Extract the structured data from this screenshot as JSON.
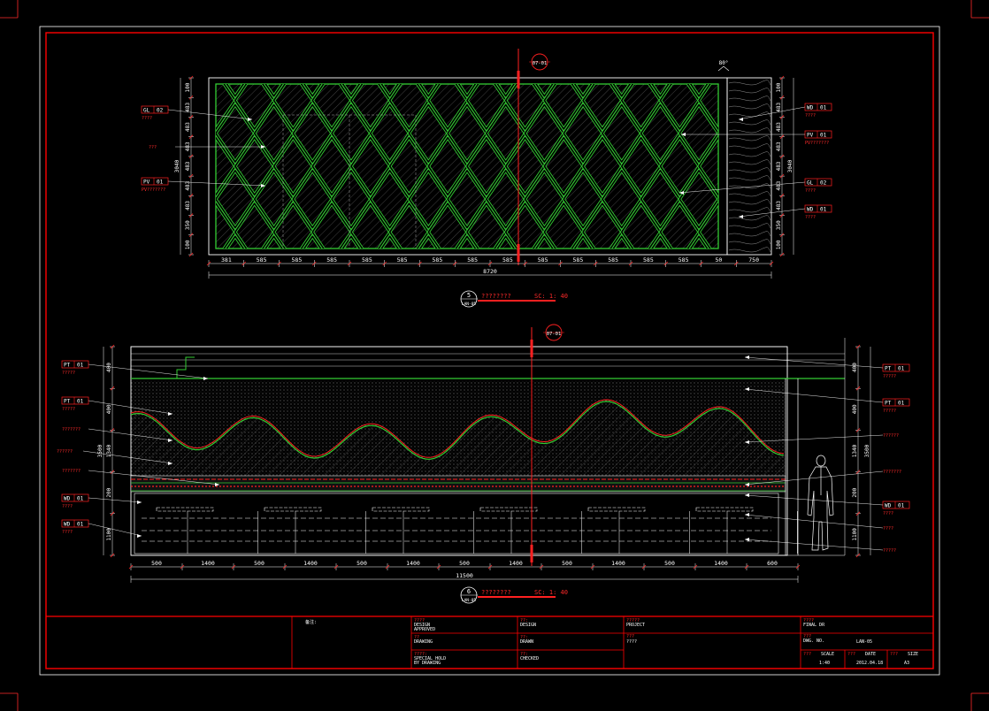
{
  "colors": {
    "background": "#000000",
    "frame": "#ff0000",
    "line": "#ffffff",
    "pattern": "#33cc33",
    "label": "#ff2a2a"
  },
  "top_elevation": {
    "section_mark": "07-01",
    "angle": "80°",
    "label_number": "5",
    "label_sheet": "LAN-05",
    "label_title": "????????",
    "label_scale": "SC: 1: 40",
    "dims_bottom": [
      "381",
      "585",
      "585",
      "585",
      "585",
      "585",
      "585",
      "585",
      "585",
      "585",
      "585",
      "585",
      "585",
      "585",
      "50",
      "750"
    ],
    "total": "8720",
    "dims_left": [
      "100",
      "483",
      "483",
      "483",
      "483",
      "483",
      "483",
      "350",
      "100"
    ],
    "dim_left_total": "3040",
    "dims_right": [
      "100",
      "483",
      "483",
      "483",
      "483",
      "483",
      "483",
      "350",
      "100"
    ],
    "dim_right_total": "3040",
    "left_tags": [
      {
        "code": "GL",
        "num": "02",
        "note": "????"
      },
      {
        "code": "",
        "num": "",
        "note": "???"
      },
      {
        "code": "PV",
        "num": "01",
        "note": "PV???????"
      }
    ],
    "right_tags": [
      {
        "code": "WD",
        "num": "01",
        "note": "????"
      },
      {
        "code": "PV",
        "num": "01",
        "note": "PV???????"
      },
      {
        "code": "GL",
        "num": "02",
        "note": "????"
      },
      {
        "code": "WD",
        "num": "01",
        "note": "????"
      }
    ]
  },
  "bottom_elevation": {
    "section_mark": "07-01",
    "label_number": "6",
    "label_sheet": "LAN-05",
    "label_title": "????????",
    "label_scale": "SC: 1: 40",
    "dims_bottom": [
      "500",
      "1400",
      "500",
      "1400",
      "500",
      "1400",
      "500",
      "1400",
      "500",
      "1400",
      "500",
      "1400",
      "600"
    ],
    "total": "11500",
    "dims_left": [
      "400",
      "400",
      "1340",
      "200",
      "1100"
    ],
    "dim_left_total": "3500",
    "dims_right": [
      "400",
      "400",
      "1340",
      "200",
      "1100"
    ],
    "dim_right_total": "3500",
    "left_tags": [
      {
        "code": "PT",
        "num": "01",
        "note": "?????"
      },
      {
        "code": "PT",
        "num": "01",
        "note": "?????"
      },
      {
        "code": "",
        "num": "",
        "note": "???????"
      },
      {
        "code": "",
        "num": "",
        "note": "??????"
      },
      {
        "code": "",
        "num": "",
        "note": "???????"
      },
      {
        "code": "WD",
        "num": "01",
        "note": "????"
      },
      {
        "code": "WD",
        "num": "01",
        "note": "????"
      }
    ],
    "right_tags": [
      {
        "code": "PT",
        "num": "01",
        "note": "?????"
      },
      {
        "code": "PT",
        "num": "01",
        "note": "?????"
      },
      {
        "code": "",
        "num": "",
        "note": "??????"
      },
      {
        "code": "",
        "num": "",
        "note": "???????"
      },
      {
        "code": "WD",
        "num": "01",
        "note": "????"
      },
      {
        "code": "",
        "num": "",
        "note": "????"
      },
      {
        "code": "",
        "num": "",
        "note": "?????"
      }
    ]
  },
  "title_block": {
    "remarks": "备注:",
    "c1": [
      "????",
      "DESIGN\nAPPROVED",
      "??",
      "DRAWING",
      "????:",
      "SPECIAL HOLD\nBY DRAWING"
    ],
    "c2": [
      "??:",
      "DESIGN",
      "??:",
      "DRAWN",
      "??:",
      "CHECKED"
    ],
    "c3": [
      "?????",
      "PROJECT",
      "???",
      "????"
    ],
    "c4": [
      "????",
      "FINAL DR",
      "???",
      "DWG. NO.",
      "LAN-05"
    ],
    "scale_label": "SCALE",
    "scale_prefix": "???",
    "scale": "1:40",
    "date_label": "DATE",
    "date_prefix": "???",
    "date": "2012.04.18",
    "size_label": "SIZE",
    "size_prefix": "???",
    "size": "A3"
  }
}
